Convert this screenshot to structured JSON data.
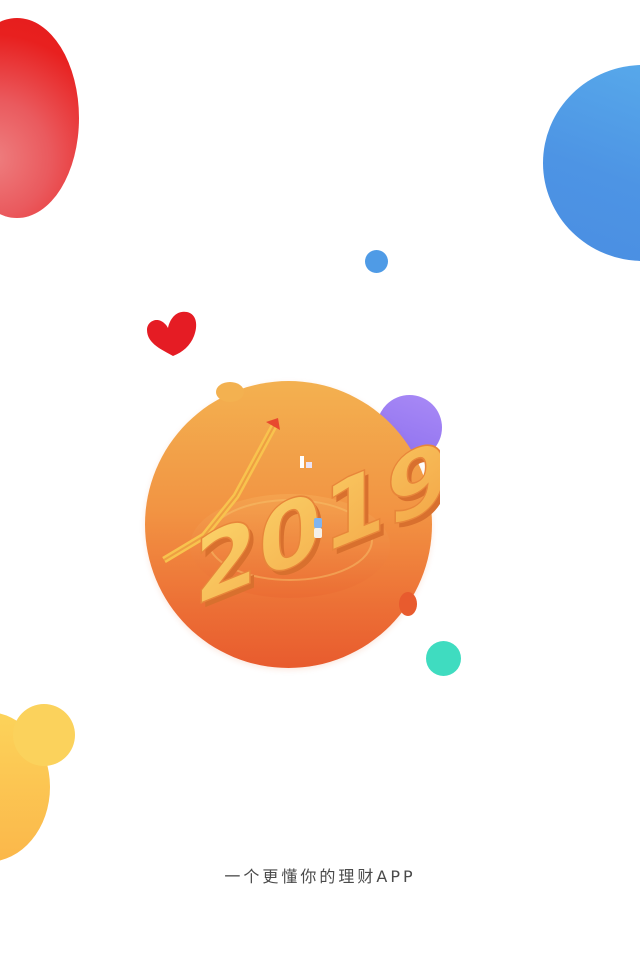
{
  "splash": {
    "year": "2019",
    "tagline": "一个更懂你的理财APP"
  },
  "colors": {
    "red": "#e51c1c",
    "blue": "#4d94e4",
    "purple": "#8d70ef",
    "teal": "#3fdcc0",
    "yellow": "#fbd25c",
    "orange": "#f29443",
    "background": "#ffffff"
  },
  "icons": [
    "heart-icon",
    "growth-arrow-icon"
  ]
}
